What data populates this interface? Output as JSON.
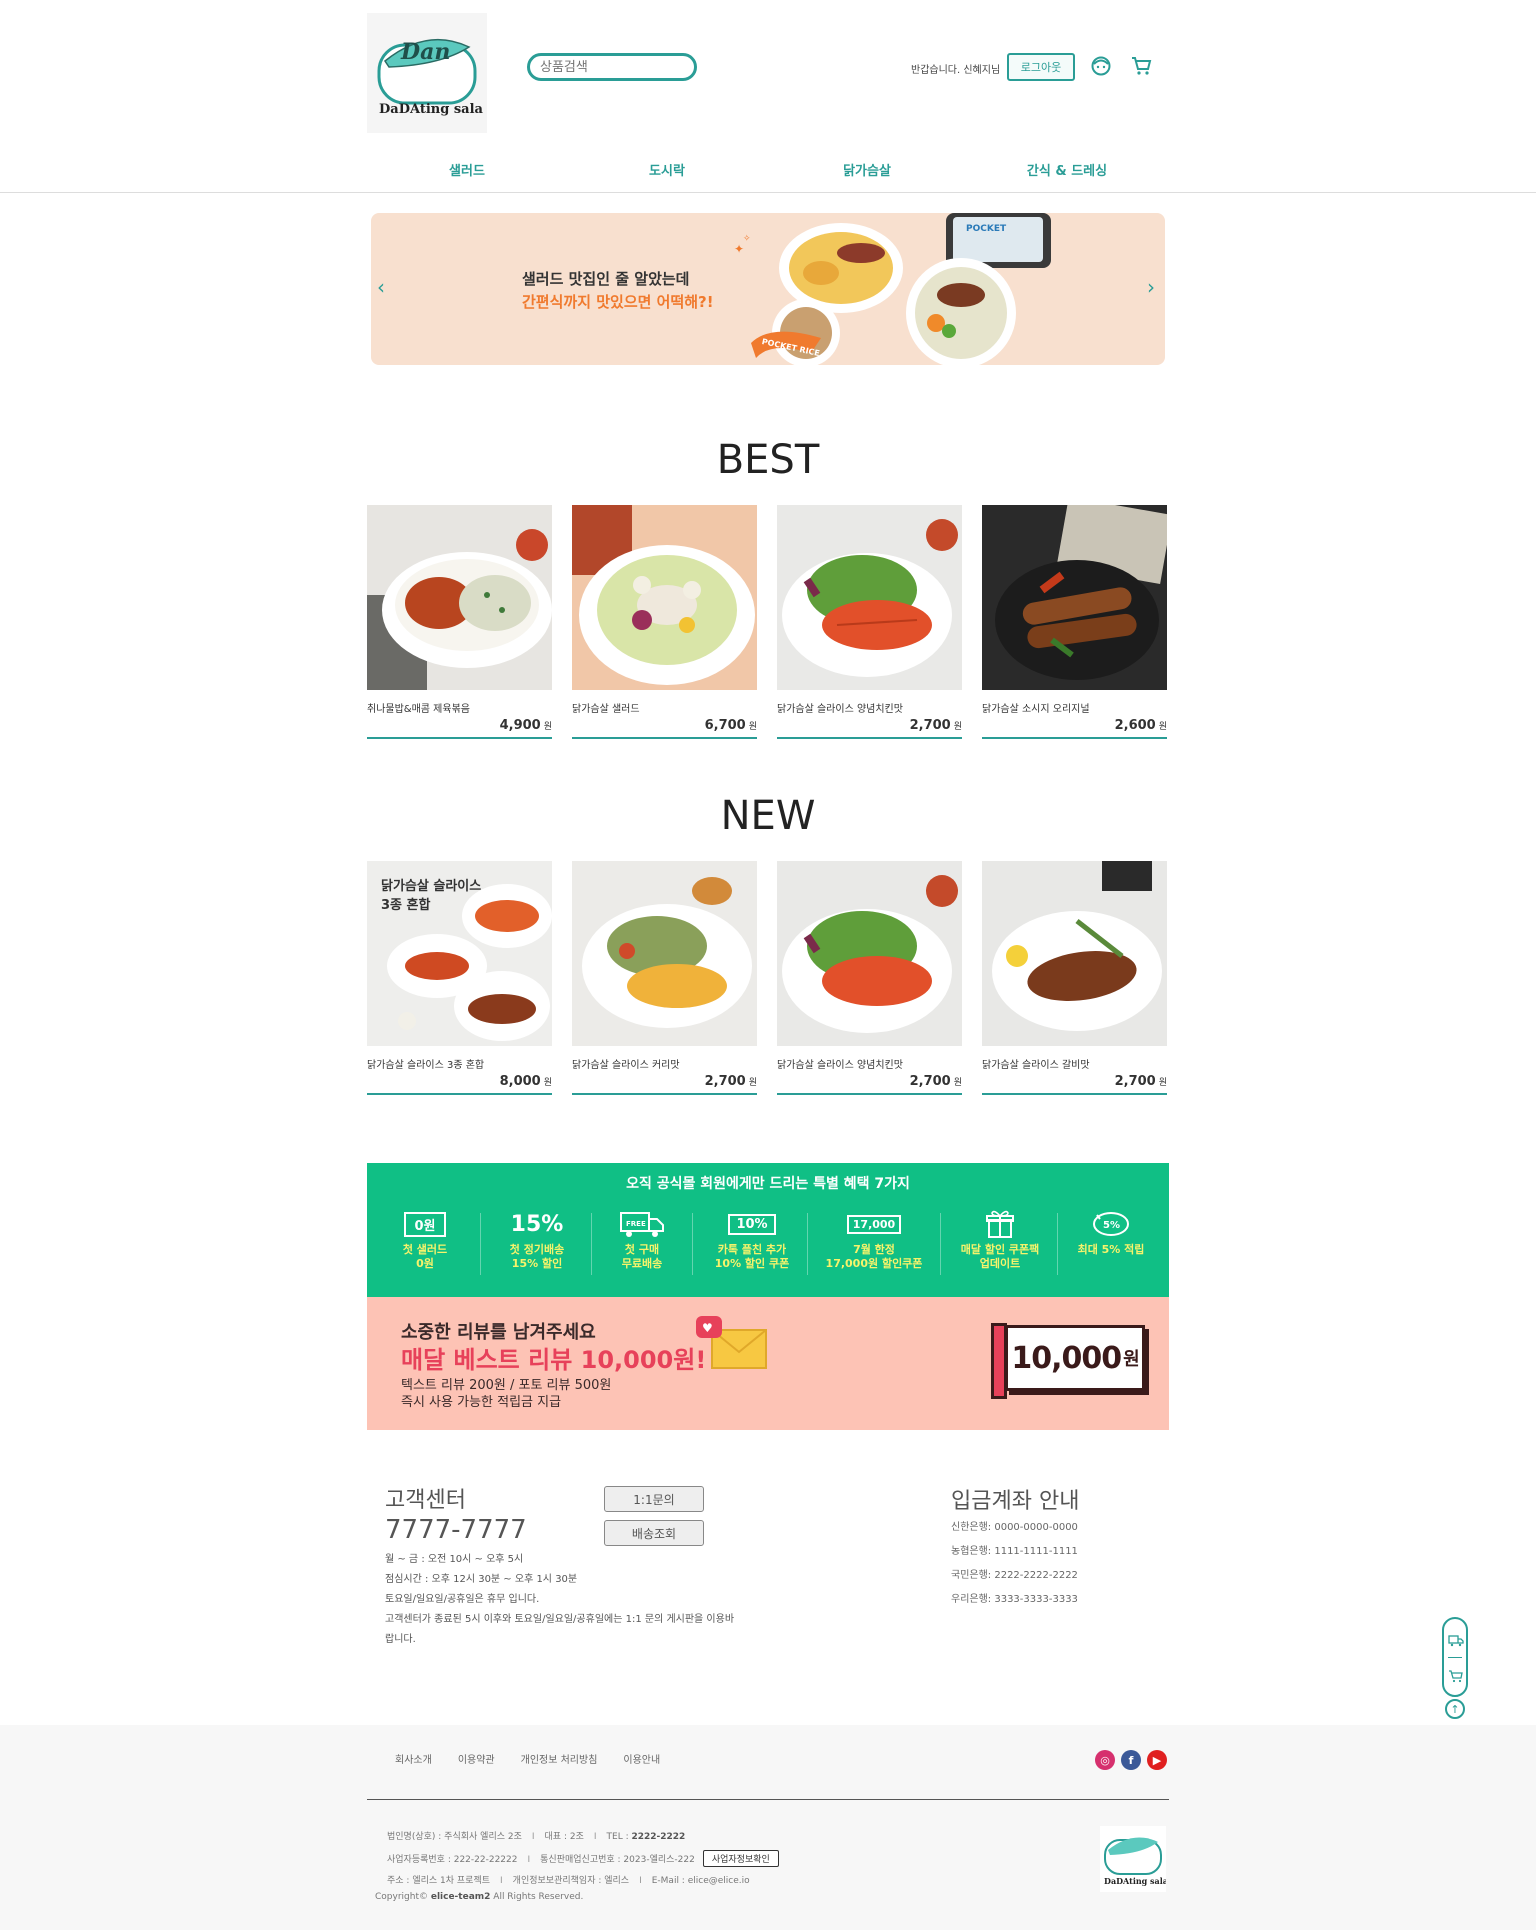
{
  "header": {
    "search_placeholder": "상품검색",
    "greeting": "반갑습니다. 신혜지님",
    "logout_label": "로그아웃",
    "logo_text": "DaDAting salad"
  },
  "nav": [
    "샐러드",
    "도시락",
    "닭가슴살",
    "간식 & 드레싱"
  ],
  "banner": {
    "line1": "샐러드 맛집인 줄 알았는데",
    "line2": "간편식까지 맛있으면 어떡해?!",
    "product_tag": "POCKET RICE",
    "package_label": "POCKET"
  },
  "best": {
    "title": "BEST",
    "items": [
      {
        "name": "취나물밥&매콤 제육볶음",
        "price": "4,900",
        "unit": "원"
      },
      {
        "name": "닭가슴살 샐러드",
        "price": "6,700",
        "unit": "원"
      },
      {
        "name": "닭가슴살 슬라이스 양념치킨맛",
        "price": "2,700",
        "unit": "원"
      },
      {
        "name": "닭가슴살 소시지 오리지널",
        "price": "2,600",
        "unit": "원"
      }
    ]
  },
  "new": {
    "title": "NEW",
    "overlay": [
      "닭가슴살 슬라이스",
      "3종 혼합"
    ],
    "items": [
      {
        "name": "닭가슴살 슬라이스 3종 혼합",
        "price": "8,000",
        "unit": "원"
      },
      {
        "name": "닭가슴살 슬라이스 커리맛",
        "price": "2,700",
        "unit": "원"
      },
      {
        "name": "닭가슴살 슬라이스 양념치킨맛",
        "price": "2,700",
        "unit": "원"
      },
      {
        "name": "닭가슴살 슬라이스 갈비맛",
        "price": "2,700",
        "unit": "원"
      }
    ]
  },
  "benefits": {
    "heading": "오직 공식몰 회원에게만 드리는 특별 혜택 7가지",
    "items": [
      {
        "icon": "0원",
        "l1": "첫 샐러드",
        "l2": "0원"
      },
      {
        "icon": "15%",
        "l1": "첫 정기배송",
        "l2": "15% 할인"
      },
      {
        "icon": "FREE",
        "l1": "첫 구매",
        "l2": "무료배송"
      },
      {
        "icon": "10%",
        "l1": "카톡 플친 추가",
        "l2": "10% 할인 쿠폰"
      },
      {
        "icon": "17,000",
        "l1": "7월 한정",
        "l2": "17,000원 할인쿠폰"
      },
      {
        "icon": "gift",
        "l1": "매달 할인 쿠폰팩",
        "l2": "업데이트"
      },
      {
        "icon": "5%",
        "l1": "최대 5% 적립",
        "l2": ""
      }
    ]
  },
  "review": {
    "line1": "소중한 리뷰를 남겨주세요",
    "line2": "매달 베스트 리뷰 10,000원!",
    "line3": "텍스트 리뷰 200원 / 포토 리뷰 500원",
    "line4": "즉시 사용 가능한 적립금 지급",
    "voucher": "10,000",
    "voucher_unit": "원"
  },
  "customer": {
    "title": "고객센터",
    "tel": "7777-7777",
    "hours": [
      "월 ~ 금 : 오전 10시 ~ 오후 5시",
      "점심시간 : 오후 12시 30분 ~ 오후 1시 30분",
      "토요일/일요일/공휴일은 휴무 입니다.",
      "고객센터가 종료된 5시 이후와 토요일/일요일/공휴일에는 1:1 문의 게시판을 이용바",
      "랍니다."
    ],
    "btn_inquiry": "1:1문의",
    "btn_delivery": "배송조회"
  },
  "bank": {
    "title": "입금계좌 안내",
    "accounts": [
      "신한은행: 0000-0000-0000",
      "농협은행: 1111-1111-1111",
      "국민은행: 2222-2222-2222",
      "우리은행: 3333-3333-3333"
    ]
  },
  "footer": {
    "links": [
      "회사소개",
      "이용약관",
      "개인정보 처리방침",
      "이용안내"
    ],
    "company": "법인명(상호) : 주식회사 엘리스 2조",
    "ceo": "대표 : 2조",
    "tel_label": "TEL :",
    "tel": "2222-2222",
    "biz_no": "사업자등록번호 : 222-22-22222",
    "mail_order": "통신판매업신고번호 : 2023-엘리스-222",
    "biz_btn": "사업자정보확인",
    "address": "주소 : 엘리스 1차 프로젝트",
    "privacy_mgr": "개인정보보관리책임자 : 엘리스",
    "email": "E-Mail : elice@elice.io",
    "copyright_prefix": "Copyright© ",
    "copyright_name": "elice-team2",
    "copyright_suffix": " All Rights Reserved."
  },
  "colors": {
    "accent": "#2a9d96",
    "benefit_bg": "#10bf85",
    "review_bg": "#fdc3b5",
    "banner_bg": "#f8e0cf"
  }
}
